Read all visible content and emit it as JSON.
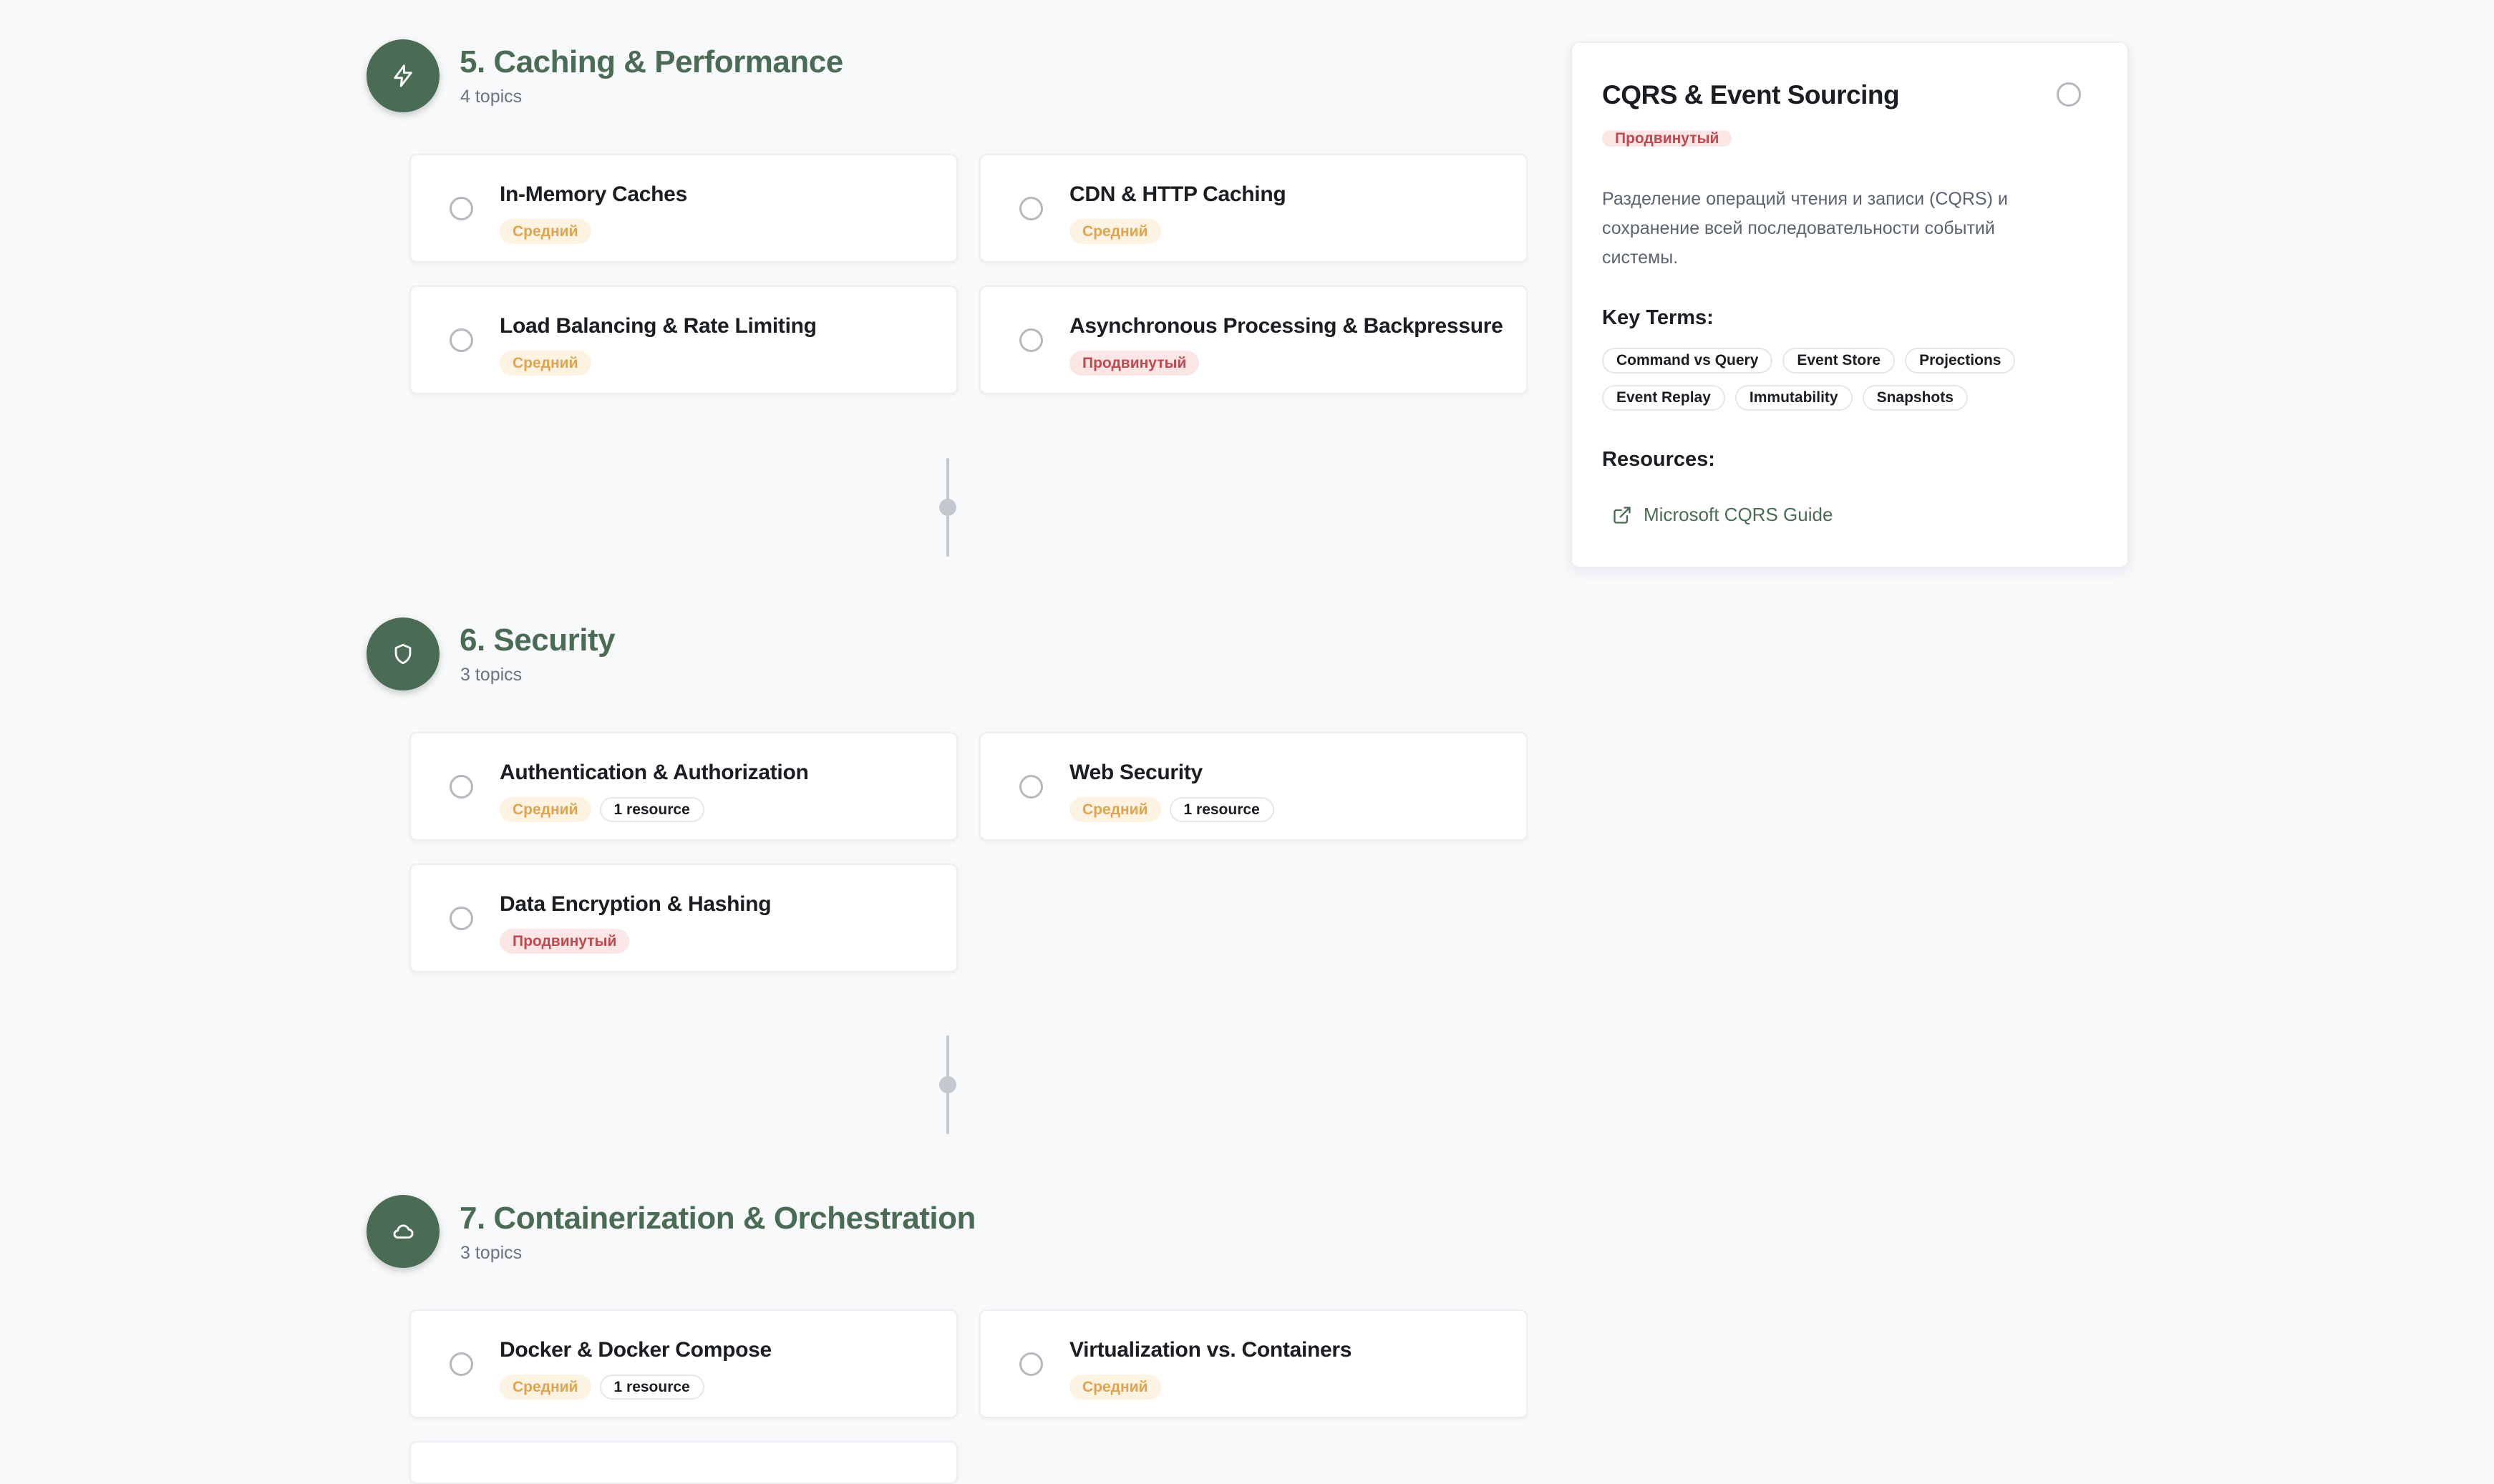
{
  "sections": [
    {
      "title": "5. Caching & Performance",
      "count": "4 topics",
      "icon": "lightning-icon",
      "topics": [
        {
          "title": "In-Memory Caches",
          "level": "Средний"
        },
        {
          "title": "CDN & HTTP Caching",
          "level": "Средний"
        },
        {
          "title": "Load Balancing & Rate Limiting",
          "level": "Средний"
        },
        {
          "title": "Asynchronous Processing & Backpressure",
          "level": "Продвинутый"
        }
      ]
    },
    {
      "title": "6. Security",
      "count": "3 topics",
      "icon": "shield-icon",
      "topics": [
        {
          "title": "Authentication & Authorization",
          "level": "Средний",
          "resources": "1 resource"
        },
        {
          "title": "Web Security",
          "level": "Средний",
          "resources": "1 resource"
        },
        {
          "title": "Data Encryption & Hashing",
          "level": "Продвинутый"
        }
      ]
    },
    {
      "title": "7. Containerization & Orchestration",
      "count": "3 topics",
      "icon": "cloud-icon",
      "topics": [
        {
          "title": "Docker & Docker Compose",
          "level": "Средний",
          "resources": "1 resource"
        },
        {
          "title": "Virtualization vs. Containers",
          "level": "Средний"
        }
      ]
    }
  ],
  "detail": {
    "title": "CQRS & Event Sourcing",
    "level": "Продвинутый",
    "description": "Разделение операций чтения и записи (CQRS) и сохранение всей последовательности событий системы.",
    "key_terms_heading": "Key Terms:",
    "key_terms": [
      "Command vs Query",
      "Event Store",
      "Projections",
      "Event Replay",
      "Immutability",
      "Snapshots"
    ],
    "resources_heading": "Resources:",
    "resources": [
      {
        "label": "Microsoft CQRS Guide",
        "icon": "external-link-icon"
      }
    ]
  },
  "colors": {
    "accent": "#4a6b54",
    "background": "#f8f9fb",
    "level_mid_text": "#e0a44e",
    "level_mid_bg": "#fdf3e2",
    "level_adv_text": "#c0484e",
    "level_adv_bg": "#fbe6e6"
  }
}
